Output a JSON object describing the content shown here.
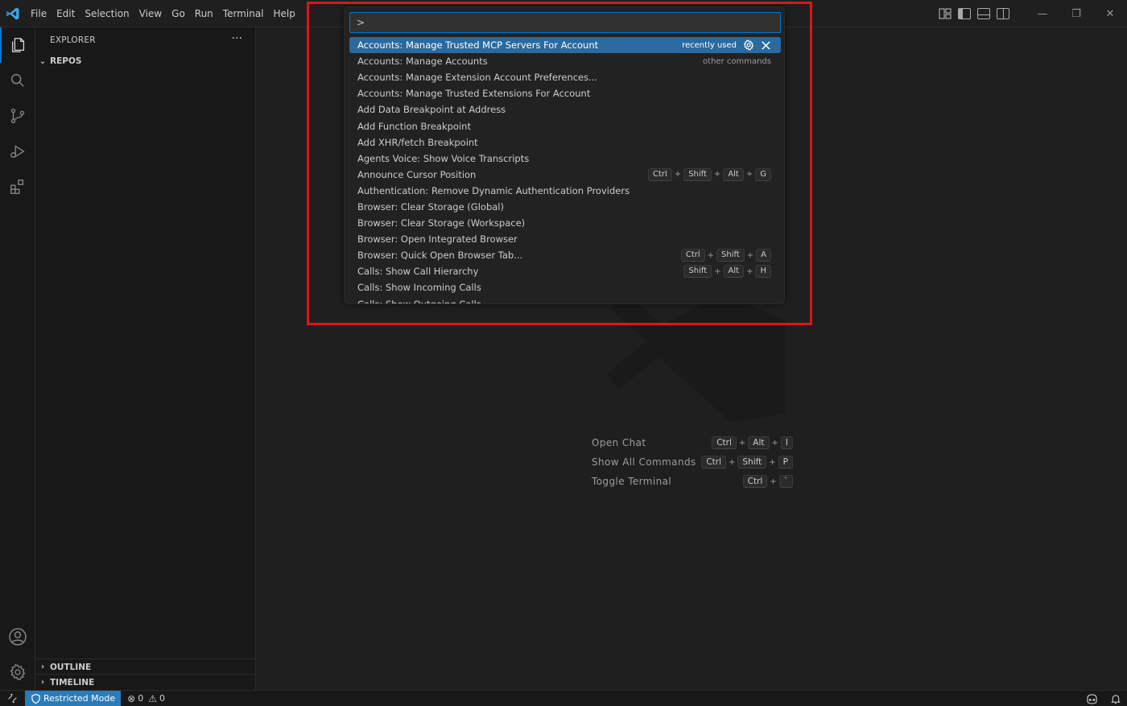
{
  "menu": [
    "File",
    "Edit",
    "Selection",
    "View",
    "Go",
    "Run",
    "Terminal",
    "Help"
  ],
  "sidebar": {
    "title": "EXPLORER",
    "more": "···",
    "sections": {
      "repos": "REPOS",
      "outline": "OUTLINE",
      "timeline": "TIMELINE"
    }
  },
  "quick_pick": {
    "input_value": ">",
    "items": [
      {
        "label": "Accounts: Manage Trusted MCP Servers For Account",
        "hint": "recently used"
      },
      {
        "label": "Accounts: Manage Accounts",
        "hint": "other commands"
      },
      {
        "label": "Accounts: Manage Extension Account Preferences..."
      },
      {
        "label": "Accounts: Manage Trusted Extensions For Account"
      },
      {
        "label": "Add Data Breakpoint at Address"
      },
      {
        "label": "Add Function Breakpoint"
      },
      {
        "label": "Add XHR/fetch Breakpoint"
      },
      {
        "label": "Agents Voice: Show Voice Transcripts"
      },
      {
        "label": "Announce Cursor Position",
        "keys": [
          "Ctrl",
          "Shift",
          "Alt",
          "G"
        ]
      },
      {
        "label": "Authentication: Remove Dynamic Authentication Providers"
      },
      {
        "label": "Browser: Clear Storage (Global)"
      },
      {
        "label": "Browser: Clear Storage (Workspace)"
      },
      {
        "label": "Browser: Open Integrated Browser"
      },
      {
        "label": "Browser: Quick Open Browser Tab...",
        "keys": [
          "Ctrl",
          "Shift",
          "A"
        ]
      },
      {
        "label": "Calls: Show Call Hierarchy",
        "keys": [
          "Shift",
          "Alt",
          "H"
        ]
      },
      {
        "label": "Calls: Show Incoming Calls"
      },
      {
        "label": "Calls: Show Outgoing Calls"
      }
    ]
  },
  "editor_shortcuts": [
    {
      "label": "Open Chat",
      "keys": [
        "Ctrl",
        "Alt",
        "I"
      ]
    },
    {
      "label": "Show All Commands",
      "keys": [
        "Ctrl",
        "Shift",
        "P"
      ]
    },
    {
      "label": "Toggle Terminal",
      "keys": [
        "Ctrl",
        "`"
      ]
    }
  ],
  "status": {
    "restricted": "Restricted Mode",
    "errors": "0",
    "warnings": "0"
  },
  "colors": {
    "accent": "#0078d4",
    "highlight": "#e0131b",
    "selected_item": "#2a6a9e"
  }
}
